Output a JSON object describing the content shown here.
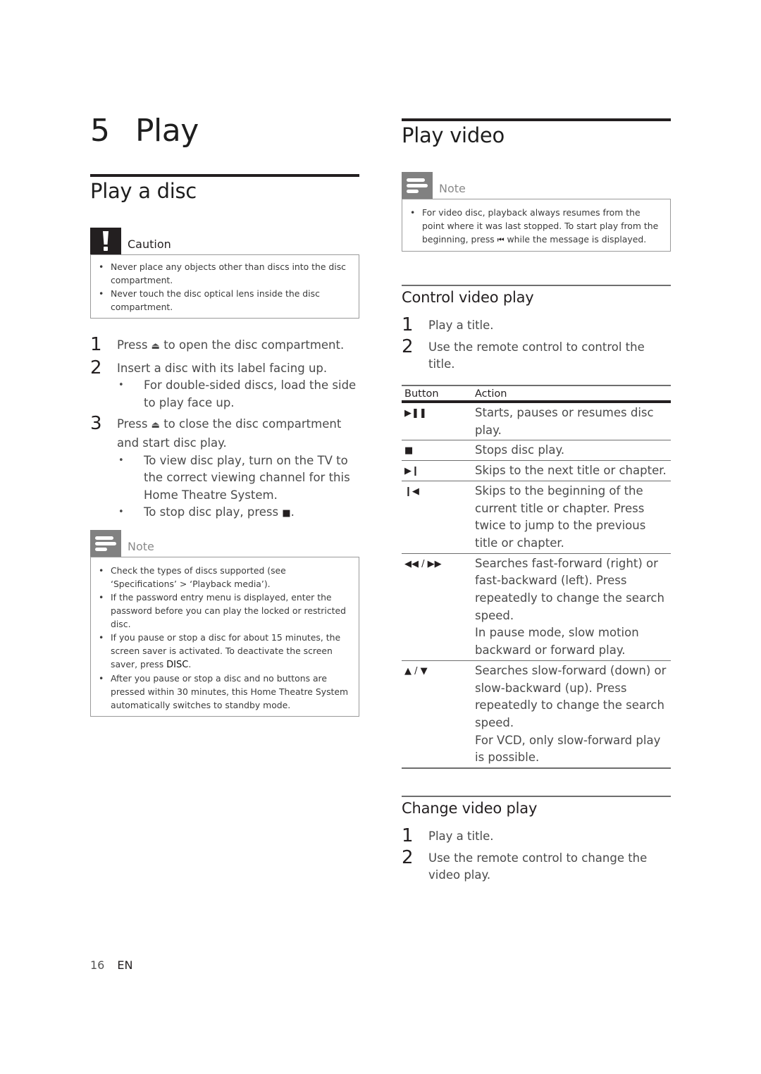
{
  "chapter": {
    "number": "5",
    "title": "Play"
  },
  "left": {
    "section_title": "Play a disc",
    "caution": {
      "icon": "exclamation-icon",
      "title": "Caution",
      "items": [
        "Never place any objects other than discs into the disc compartment.",
        "Never touch the disc optical lens inside the disc compartment."
      ]
    },
    "steps": [
      {
        "num": "1",
        "text_before": "Press ",
        "icon": "eject-icon",
        "glyph": "⏏",
        "text_after": " to open the disc compartment.",
        "subs": []
      },
      {
        "num": "2",
        "text_before": "Insert a disc with its label facing up.",
        "icon": "",
        "glyph": "",
        "text_after": "",
        "subs": [
          {
            "text_before": "For double-sided discs, load the side to play face up.",
            "glyph": "",
            "text_after": ""
          }
        ]
      },
      {
        "num": "3",
        "text_before": "Press ",
        "icon": "eject-icon",
        "glyph": "⏏",
        "text_after": " to close the disc compartment and start disc play.",
        "subs": [
          {
            "text_before": "To view disc play, turn on the TV to the correct viewing channel for this Home Theatre System.",
            "glyph": "",
            "text_after": ""
          },
          {
            "text_before": "To stop disc play, press ",
            "glyph": "■",
            "text_after": "."
          }
        ]
      }
    ],
    "note": {
      "icon": "note-lines-icon",
      "title": "Note",
      "items": [
        {
          "text": "Check the types of discs supported (see ‘Specifications’ > ‘Playback media’).",
          "bold": "",
          "after": ""
        },
        {
          "text": "If the password entry menu is displayed, enter the password before you can play the locked or restricted disc.",
          "bold": "",
          "after": ""
        },
        {
          "text": "If you pause or stop a disc for about 15 minutes, the screen saver is activated. To deactivate the screen saver, press ",
          "bold": "DISC",
          "after": "."
        },
        {
          "text": "After you pause or stop a disc and no buttons are pressed within 30 minutes, this Home Theatre System automatically switches to standby mode.",
          "bold": "",
          "after": ""
        }
      ]
    }
  },
  "right": {
    "section_title": "Play video",
    "note": {
      "icon": "note-lines-icon",
      "title": "Note",
      "text_before": "For video disc, playback always resumes from the point where it was last stopped. To start play from the beginning, press ",
      "glyph": "⏮",
      "text_after": " while the message is displayed."
    },
    "control": {
      "title": "Control video play",
      "steps": [
        {
          "num": "1",
          "text": "Play a title."
        },
        {
          "num": "2",
          "text": "Use the remote control to control the title."
        }
      ],
      "table": {
        "headers": [
          "Button",
          "Action"
        ],
        "rows": [
          {
            "icon": "play-pause-icon",
            "button": "▶❚❚",
            "action": [
              "Starts, pauses or resumes disc play."
            ]
          },
          {
            "icon": "stop-icon",
            "button": "■",
            "action": [
              "Stops disc play."
            ]
          },
          {
            "icon": "next-icon",
            "button": "▶❙",
            "action": [
              "Skips to the next title or chapter."
            ]
          },
          {
            "icon": "previous-icon",
            "button": "❙◀",
            "action": [
              "Skips to the beginning of the current title or chapter. Press twice to jump to the previous title or chapter."
            ]
          },
          {
            "icon": "rewind-fast-forward-icon",
            "button": "◀◀ / ▶▶",
            "action": [
              "Searches fast-forward (right) or fast-backward (left). Press repeatedly to change the search speed.",
              "In pause mode, slow motion backward or forward play."
            ]
          },
          {
            "icon": "up-down-icon",
            "button": "▲ / ▼",
            "action": [
              "Searches slow-forward (down) or slow-backward (up). Press repeatedly to change the search speed.",
              "For VCD, only slow-forward play is possible."
            ]
          }
        ]
      }
    },
    "change": {
      "title": "Change video play",
      "steps": [
        {
          "num": "1",
          "text": "Play a title."
        },
        {
          "num": "2",
          "text": "Use the remote control to change the video play."
        }
      ]
    }
  },
  "footer": {
    "page": "16",
    "lang": "EN"
  }
}
